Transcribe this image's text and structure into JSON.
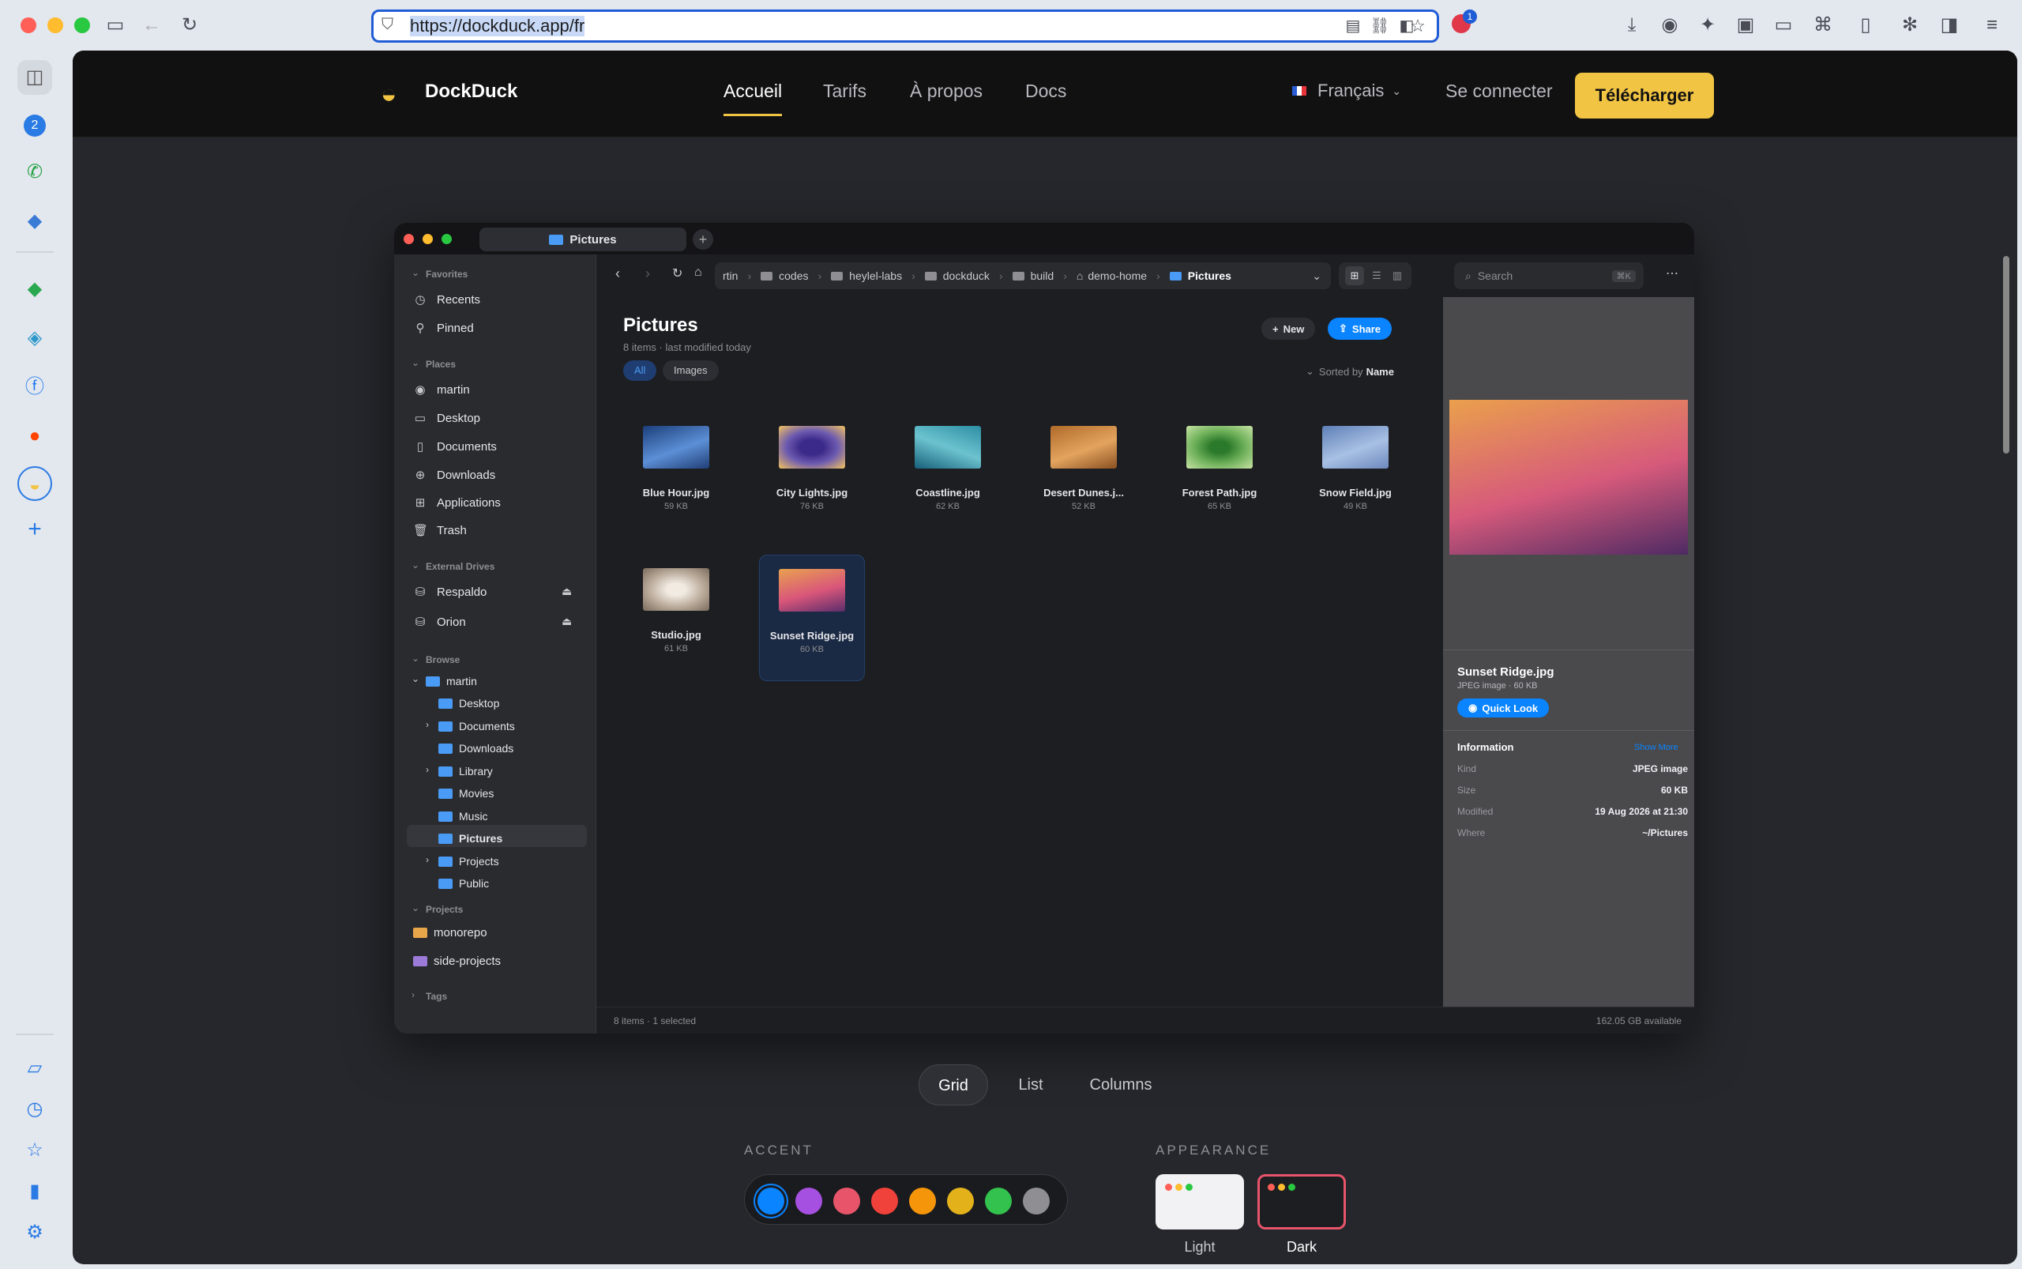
{
  "browser": {
    "url": "https://dockduck.app/fr",
    "notification_count": "1",
    "sidebar_badge": "2"
  },
  "site": {
    "brand": "DockDuck",
    "nav": [
      "Accueil",
      "Tarifs",
      "À propos",
      "Docs"
    ],
    "language": "Français",
    "login": "Se connecter",
    "cta": "Télécharger"
  },
  "demo": {
    "tab_title": "Pictures",
    "sidebar": {
      "favorites_header": "Favorites",
      "favorites": [
        "Recents",
        "Pinned"
      ],
      "places_header": "Places",
      "places": [
        "martin",
        "Desktop",
        "Documents",
        "Downloads",
        "Applications",
        "Trash"
      ],
      "drives_header": "External Drives",
      "drives": [
        "Respaldo",
        "Orion"
      ],
      "browse_header": "Browse",
      "browse_root": "martin",
      "browse_children": [
        "Desktop",
        "Documents",
        "Downloads",
        "Library",
        "Movies",
        "Music",
        "Pictures",
        "Projects",
        "Public"
      ],
      "projects_header": "Projects",
      "projects": [
        "monorepo",
        "side-projects"
      ],
      "tags_header": "Tags"
    },
    "breadcrumb": [
      "rtin",
      "codes",
      "heylel-labs",
      "dockduck",
      "build",
      "demo-home",
      "Pictures"
    ],
    "search_placeholder": "Search",
    "search_shortcut": "⌘K",
    "folder": {
      "title": "Pictures",
      "subtitle": "8 items · last modified today",
      "new_label": "New",
      "share_label": "Share",
      "filters": [
        "All",
        "Images"
      ],
      "sorted_prefix": "Sorted by",
      "sorted_field": "Name"
    },
    "files": [
      {
        "name": "Blue Hour.jpg",
        "size": "59 KB"
      },
      {
        "name": "City Lights.jpg",
        "size": "76 KB"
      },
      {
        "name": "Coastline.jpg",
        "size": "62 KB"
      },
      {
        "name": "Desert Dunes.j...",
        "size": "52 KB"
      },
      {
        "name": "Forest Path.jpg",
        "size": "65 KB"
      },
      {
        "name": "Snow Field.jpg",
        "size": "49 KB"
      },
      {
        "name": "Studio.jpg",
        "size": "61 KB"
      },
      {
        "name": "Sunset Ridge.jpg",
        "size": "60 KB"
      }
    ],
    "status_left": "8 items · 1 selected",
    "status_right": "162.05 GB available",
    "preview": {
      "name": "Sunset Ridge.jpg",
      "meta": "JPEG image · 60 KB",
      "quick_look": "Quick Look",
      "info_header": "Information",
      "show_more": "Show More",
      "rows": [
        {
          "k": "Kind",
          "v": "JPEG image"
        },
        {
          "k": "Size",
          "v": "60 KB"
        },
        {
          "k": "Modified",
          "v": "19 Aug 2026 at 21:30"
        },
        {
          "k": "Where",
          "v": "~/Pictures"
        }
      ]
    }
  },
  "controls": {
    "views": [
      "Grid",
      "List",
      "Columns"
    ],
    "accent_label": "ACCENT",
    "accent_colors": [
      "#0a84ff",
      "#a550e0",
      "#e8546a",
      "#f0413a",
      "#f5950a",
      "#e3b21a",
      "#33c24d",
      "#8e8e93"
    ],
    "appearance_label": "APPEARANCE",
    "appearance_options": [
      "Light",
      "Dark"
    ]
  }
}
